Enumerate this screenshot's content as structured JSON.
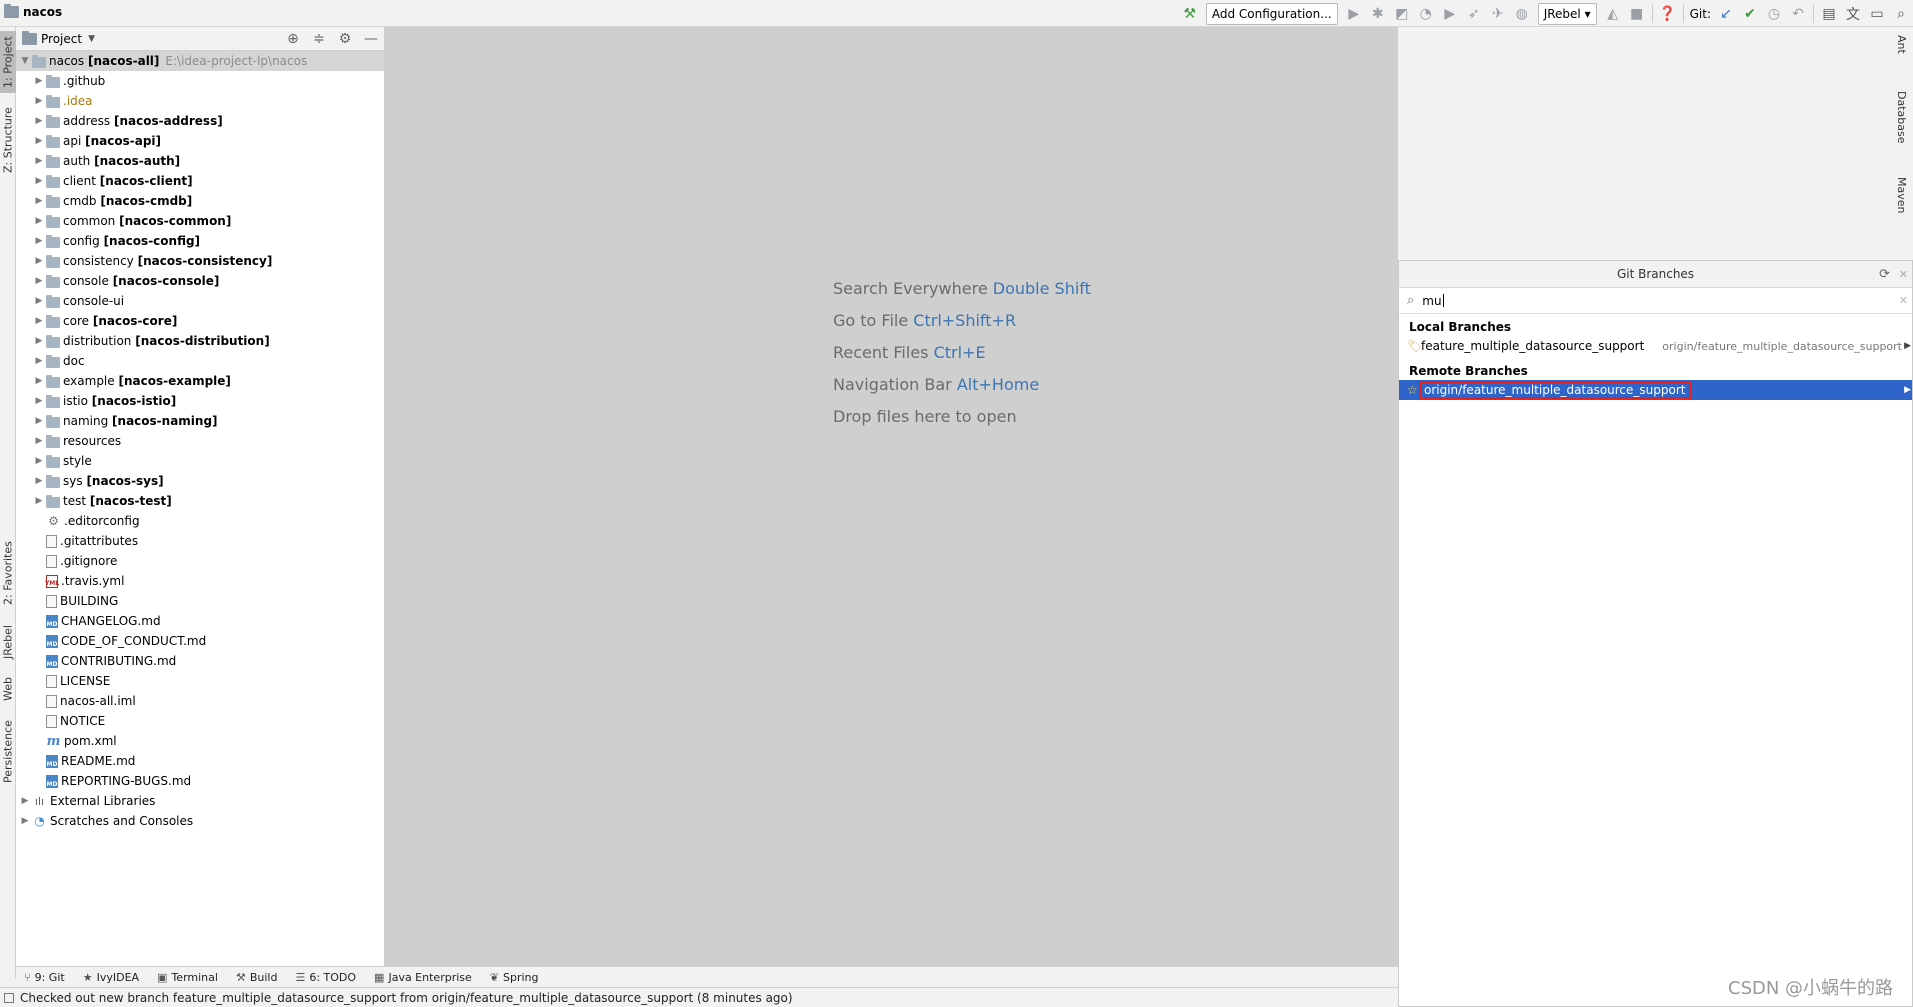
{
  "app": {
    "title": "nacos"
  },
  "toolbar": {
    "add_configuration": "Add Configuration...",
    "jrebel": "JRebel",
    "git_label": "Git:"
  },
  "left_tabs": {
    "project": "1: Project",
    "structure": "Z: Structure",
    "favorites": "2: Favorites",
    "jrebel": "JRebel",
    "web": "Web",
    "persistence": "Persistence"
  },
  "right_tabs": {
    "ant": "Ant",
    "database": "Database",
    "maven": "Maven"
  },
  "project_panel": {
    "title": "Project",
    "root": {
      "name": "nacos",
      "module": "[nacos-all]",
      "path": "E:\\idea-project-lp\\nacos"
    },
    "items": [
      {
        "name": ".github",
        "module": "",
        "type": "folder",
        "expand": true
      },
      {
        "name": ".idea",
        "module": "",
        "type": "folder",
        "expand": true,
        "style": "idea"
      },
      {
        "name": "address",
        "module": "[nacos-address]",
        "type": "folder",
        "expand": true
      },
      {
        "name": "api",
        "module": "[nacos-api]",
        "type": "folder",
        "expand": true
      },
      {
        "name": "auth",
        "module": "[nacos-auth]",
        "type": "folder",
        "expand": true
      },
      {
        "name": "client",
        "module": "[nacos-client]",
        "type": "folder",
        "expand": true
      },
      {
        "name": "cmdb",
        "module": "[nacos-cmdb]",
        "type": "folder",
        "expand": true
      },
      {
        "name": "common",
        "module": "[nacos-common]",
        "type": "folder",
        "expand": true
      },
      {
        "name": "config",
        "module": "[nacos-config]",
        "type": "folder",
        "expand": true
      },
      {
        "name": "consistency",
        "module": "[nacos-consistency]",
        "type": "folder",
        "expand": true
      },
      {
        "name": "console",
        "module": "[nacos-console]",
        "type": "folder",
        "expand": true
      },
      {
        "name": "console-ui",
        "module": "",
        "type": "folder",
        "expand": true
      },
      {
        "name": "core",
        "module": "[nacos-core]",
        "type": "folder",
        "expand": true
      },
      {
        "name": "distribution",
        "module": "[nacos-distribution]",
        "type": "folder",
        "expand": true
      },
      {
        "name": "doc",
        "module": "",
        "type": "folder",
        "expand": true
      },
      {
        "name": "example",
        "module": "[nacos-example]",
        "type": "folder",
        "expand": true
      },
      {
        "name": "istio",
        "module": "[nacos-istio]",
        "type": "folder",
        "expand": true
      },
      {
        "name": "naming",
        "module": "[nacos-naming]",
        "type": "folder",
        "expand": true
      },
      {
        "name": "resources",
        "module": "",
        "type": "folder",
        "expand": true
      },
      {
        "name": "style",
        "module": "",
        "type": "folder",
        "expand": true
      },
      {
        "name": "sys",
        "module": "[nacos-sys]",
        "type": "folder",
        "expand": true
      },
      {
        "name": "test",
        "module": "[nacos-test]",
        "type": "folder",
        "expand": true
      },
      {
        "name": ".editorconfig",
        "module": "",
        "type": "gear",
        "expand": false
      },
      {
        "name": ".gitattributes",
        "module": "",
        "type": "file",
        "expand": false
      },
      {
        "name": ".gitignore",
        "module": "",
        "type": "file",
        "expand": false
      },
      {
        "name": ".travis.yml",
        "module": "",
        "type": "yml",
        "expand": false
      },
      {
        "name": "BUILDING",
        "module": "",
        "type": "file",
        "expand": false
      },
      {
        "name": "CHANGELOG.md",
        "module": "",
        "type": "md",
        "expand": false
      },
      {
        "name": "CODE_OF_CONDUCT.md",
        "module": "",
        "type": "md",
        "expand": false
      },
      {
        "name": "CONTRIBUTING.md",
        "module": "",
        "type": "md",
        "expand": false
      },
      {
        "name": "LICENSE",
        "module": "",
        "type": "file",
        "expand": false
      },
      {
        "name": "nacos-all.iml",
        "module": "",
        "type": "file",
        "expand": false
      },
      {
        "name": "NOTICE",
        "module": "",
        "type": "file",
        "expand": false
      },
      {
        "name": "pom.xml",
        "module": "",
        "type": "maven",
        "expand": false
      },
      {
        "name": "README.md",
        "module": "",
        "type": "md",
        "expand": false
      },
      {
        "name": "REPORTING-BUGS.md",
        "module": "",
        "type": "md",
        "expand": false
      }
    ],
    "external_libraries": "External Libraries",
    "scratches": "Scratches and Consoles"
  },
  "editor_hints": [
    {
      "text": "Search Everywhere",
      "key": "Double Shift"
    },
    {
      "text": "Go to File",
      "key": "Ctrl+Shift+R"
    },
    {
      "text": "Recent Files",
      "key": "Ctrl+E"
    },
    {
      "text": "Navigation Bar",
      "key": "Alt+Home"
    },
    {
      "text": "Drop files here to open",
      "key": ""
    }
  ],
  "git_branches": {
    "title": "Git Branches",
    "search_value": "mu",
    "local_header": "Local Branches",
    "local": [
      {
        "name": "feature_multiple_datasource_support",
        "tracking": "origin/feature_multiple_datasource_support"
      }
    ],
    "remote_header": "Remote Branches",
    "remote": [
      {
        "name": "origin/feature_multiple_datasource_support"
      }
    ]
  },
  "bottom_tools": [
    {
      "icon": "git-icon",
      "glyph": "⑂",
      "label": "9: Git"
    },
    {
      "icon": "ivy-icon",
      "glyph": "★",
      "label": "IvyIDEA"
    },
    {
      "icon": "terminal-icon",
      "glyph": "▣",
      "label": "Terminal"
    },
    {
      "icon": "build-icon",
      "glyph": "⚒",
      "label": "Build"
    },
    {
      "icon": "todo-icon",
      "glyph": "☰",
      "label": "6: TODO"
    },
    {
      "icon": "java-enterprise-icon",
      "glyph": "▦",
      "label": "Java Enterprise"
    },
    {
      "icon": "spring-icon",
      "glyph": "❦",
      "label": "Spring"
    }
  ],
  "status": {
    "message": "Checked out new branch feature_multiple_datasource_support from origin/feature_multiple_datasource_support (8 minutes ago)"
  },
  "watermark": "CSDN @小蜗牛的路"
}
